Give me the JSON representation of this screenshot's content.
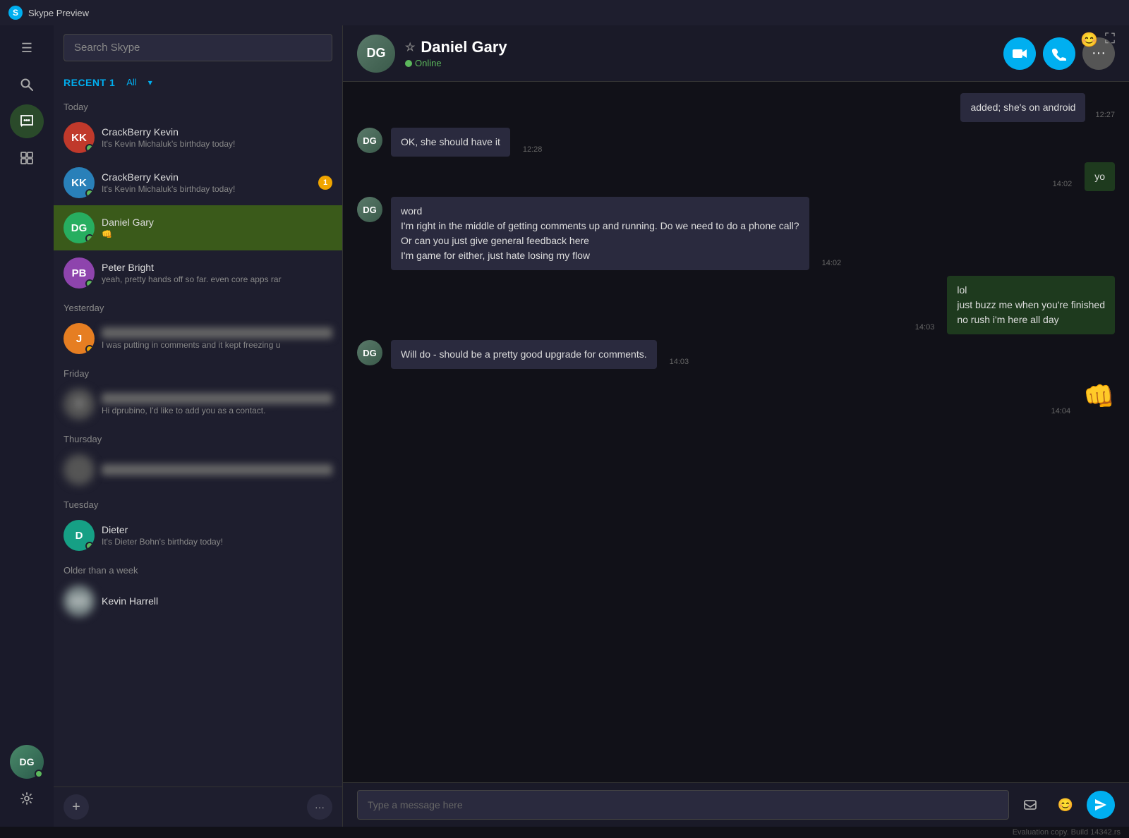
{
  "titleBar": {
    "logo": "S",
    "title": "Skype Preview"
  },
  "sidebar": {
    "icons": [
      {
        "name": "hamburger-icon",
        "symbol": "☰",
        "interactable": true
      },
      {
        "name": "search-icon",
        "symbol": "🔍",
        "interactable": true
      },
      {
        "name": "chat-icon",
        "symbol": "💬",
        "interactable": true,
        "active": true
      },
      {
        "name": "contacts-icon",
        "symbol": "📋",
        "interactable": true
      }
    ],
    "userAvatar": "DG",
    "settingsIcon": "⚙"
  },
  "contactsPanel": {
    "searchPlaceholder": "Search Skype",
    "recentLabel": "RECENT 1",
    "allButton": "All",
    "sections": [
      {
        "label": "Today",
        "contacts": [
          {
            "id": "crackberry1",
            "name": "CrackBerry Kevin",
            "preview": "It's Kevin Michaluk's birthday today!",
            "statusColor": "green",
            "avatarText": "KK",
            "avatarBg": "#c0392b",
            "unread": 0
          },
          {
            "id": "crackberry2",
            "name": "CrackBerry Kevin",
            "preview": "It's Kevin Michaluk's birthday today!",
            "statusColor": "green",
            "avatarText": "KK",
            "avatarBg": "#2980b9",
            "unread": 1
          },
          {
            "id": "danielgary",
            "name": "Daniel Gary",
            "preview": "👊",
            "statusColor": "green",
            "avatarText": "DG",
            "avatarBg": "#27ae60",
            "active": true,
            "unread": 0
          },
          {
            "id": "peterbright",
            "name": "Peter Bright",
            "preview": "yeah, pretty hands off so far. even core apps rar",
            "statusColor": "green",
            "avatarText": "PB",
            "avatarBg": "#8e44ad",
            "unread": 0
          }
        ]
      },
      {
        "label": "Yesterday",
        "contacts": [
          {
            "id": "jamie",
            "name": "Jamie",
            "preview": "I was putting in comments and it kept freezing u",
            "statusColor": "yellow",
            "avatarText": "J",
            "avatarBg": "#e67e22",
            "unread": 0,
            "blurName": true
          }
        ]
      },
      {
        "label": "Friday",
        "contacts": [
          {
            "id": "unknown1",
            "name": "",
            "preview": "Hi dprubino, I'd like to add you as a contact.",
            "statusColor": "none",
            "avatarText": "?",
            "avatarBg": "#555",
            "blurAvatar": true,
            "blurName": true,
            "unread": 0
          }
        ]
      },
      {
        "label": "Thursday",
        "contacts": [
          {
            "id": "unknown2",
            "name": "",
            "preview": "",
            "statusColor": "none",
            "avatarText": "",
            "avatarBg": "#555",
            "blurAvatar": true,
            "blurName": true,
            "unread": 0
          }
        ]
      },
      {
        "label": "Tuesday",
        "contacts": [
          {
            "id": "dieter",
            "name": "Dieter",
            "preview": "It's Dieter Bohn's birthday today!",
            "statusColor": "green",
            "avatarText": "D",
            "avatarBg": "#16a085",
            "unread": 0
          }
        ]
      },
      {
        "label": "Older than a week",
        "contacts": [
          {
            "id": "kevinharrell",
            "name": "Kevin Harrell",
            "preview": "",
            "statusColor": "none",
            "avatarText": "KH",
            "avatarBg": "#7f8c8d",
            "blurAvatar": true,
            "unread": 0
          }
        ]
      }
    ],
    "addButtonLabel": "+",
    "moreButtonLabel": "···"
  },
  "chatPanel": {
    "contactName": "Daniel Gary",
    "contactStatus": "Online",
    "starIcon": "☆",
    "emojiIcon": "😊",
    "expandIcon": "⛶",
    "videoCallIcon": "📹",
    "audioCallIcon": "📞",
    "moreIcon": "···",
    "messages": [
      {
        "id": "msg1",
        "type": "system",
        "text": "added; she's on android",
        "time": "12:27",
        "mine": true
      },
      {
        "id": "msg2",
        "type": "received",
        "text": "OK, she should have it",
        "time": "12:28",
        "mine": false
      },
      {
        "id": "msg3",
        "type": "sent",
        "text": "yo",
        "time": "14:02",
        "mine": true
      },
      {
        "id": "msg4",
        "type": "received",
        "text": "word\nI'm right in the middle of getting comments up and running.  Do we need to do a phone call?\nOr can you just give general feedback here\nI'm game for either, just hate losing my flow",
        "time": "14:02",
        "mine": false
      },
      {
        "id": "msg5",
        "type": "sent",
        "text": "lol\njust buzz me when you're finished\nno rush i'm here all day",
        "time": "14:03",
        "mine": true
      },
      {
        "id": "msg6",
        "type": "received",
        "text": "Will do - should be a pretty good upgrade for comments.",
        "time": "14:03",
        "mine": false
      },
      {
        "id": "msg7",
        "type": "sent",
        "text": "👊",
        "time": "14:04",
        "mine": true,
        "isEmoji": true
      }
    ],
    "inputPlaceholder": "Type a message here",
    "fileIcon": "📁",
    "emojiInputIcon": "😊",
    "sendIcon": "➤"
  },
  "bottomBar": {
    "text": "Evaluation copy. Build 14342.rs"
  }
}
